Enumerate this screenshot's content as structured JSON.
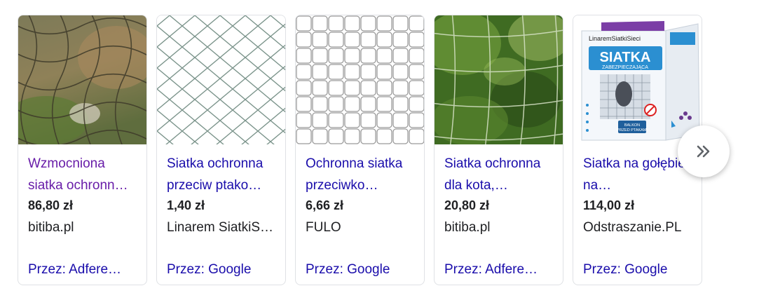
{
  "products": [
    {
      "title": "Wzmocniona siatka ochronn…",
      "price": "86,80 zł",
      "seller": "bitiba.pl",
      "via": "Przez: Adfere…",
      "visited": true,
      "image": "brown-net-photo"
    },
    {
      "title": "Siatka ochronna przeciw ptako…",
      "price": "1,40 zł",
      "seller": "Linarem SiatkiS…",
      "via": "Przez: Google",
      "visited": false,
      "image": "green-diamond-net"
    },
    {
      "title": "Ochronna siatka przeciwko…",
      "price": "6,66 zł",
      "seller": "FULO",
      "via": "Przez: Google",
      "visited": false,
      "image": "grey-square-net"
    },
    {
      "title": "Siatka ochronna dla kota,…",
      "price": "20,80 zł",
      "seller": "bitiba.pl",
      "via": "Przez: Adfere…",
      "visited": false,
      "image": "net-over-foliage-photo"
    },
    {
      "title": "Siatka na gołębie na…",
      "price": "114,00 zł",
      "seller": "Odstraszanie.PL",
      "via": "Przez: Google",
      "visited": false,
      "image": "product-box"
    }
  ],
  "product_box": {
    "brand": "LinaremSiatkiSieci",
    "name": "SIATKA",
    "tagline": "ZABEZPIECZAJĄCA",
    "badge_line1": "BALKON",
    "badge_line2": "PRZED PTAKAMI"
  },
  "next_button_icon": "double-chevron-right-icon",
  "colors": {
    "link": "#1a0dab",
    "visited_link": "#681da8",
    "text": "#202124",
    "border": "#dfe1e5"
  }
}
